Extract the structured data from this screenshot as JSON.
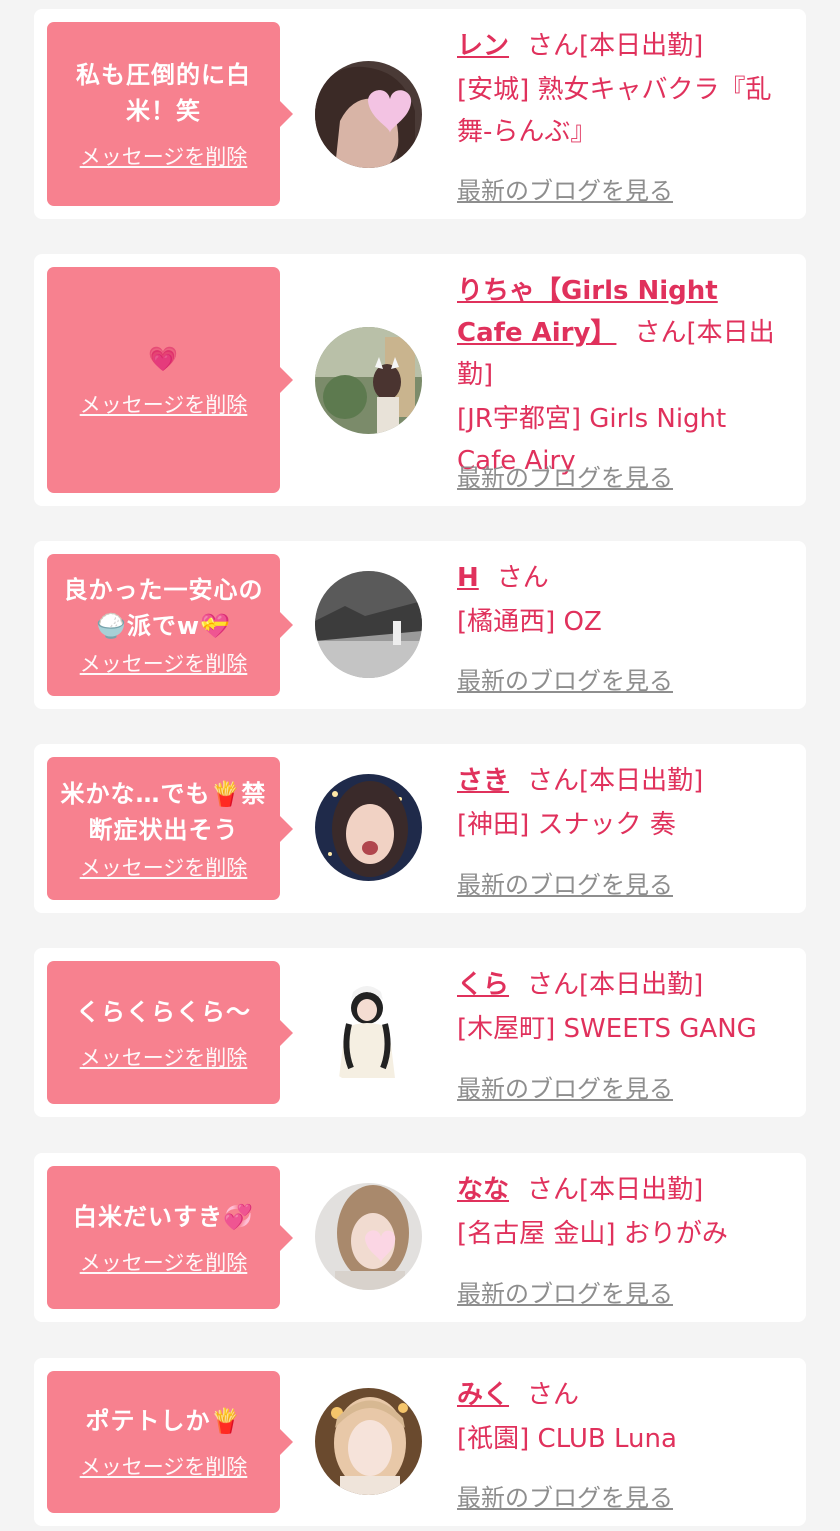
{
  "common": {
    "delete_label": "メッセージを削除",
    "blog_label": "最新のブログを見る",
    "san": "さん"
  },
  "colors": {
    "bubble": "#f7818f",
    "accent": "#e0315c",
    "muted": "#8e8e8e",
    "background": "#f4f4f4"
  },
  "items": [
    {
      "message": "私も圧倒的に白米！笑",
      "name": "レン",
      "status": "[本日出勤]",
      "shop": "[安城] 熟女キャバクラ『乱舞-らんぶ』"
    },
    {
      "message": "💗",
      "name": "りちゃ【Girls Night Cafe Airy】",
      "status": "[本日出勤]",
      "shop": "[JR宇都宮] Girls Night Cafe Airy"
    },
    {
      "message": "良かった一安心の🍚派でw💝",
      "name": "H",
      "status": "",
      "shop": "[橘通西] OZ"
    },
    {
      "message": "米かな…でも🍟禁断症状出そう",
      "name": "さき",
      "status": "[本日出勤]",
      "shop": "[神田] スナック 奏"
    },
    {
      "message": "くらくらくら〜",
      "name": "くら",
      "status": "[本日出勤]",
      "shop": "[木屋町] SWEETS GANG"
    },
    {
      "message": "白米だいすき💞",
      "name": "なな",
      "status": "[本日出勤]",
      "shop": "[名古屋 金山] おりがみ"
    },
    {
      "message": "ポテトしか🍟",
      "name": "みく",
      "status": "",
      "shop": "[祇園] CLUB Luna"
    }
  ]
}
